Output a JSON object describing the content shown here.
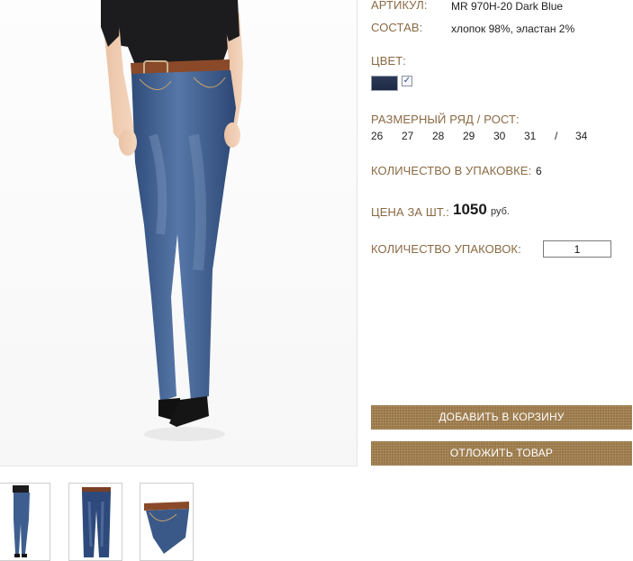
{
  "product": {
    "article_label": "АРТИКУЛ:",
    "article_value": "MR 970H-20 Dark Blue",
    "composition_label": "СОСТАВ:",
    "composition_value": "хлопок 98%, эластан 2%",
    "color_label": "ЦВЕТ:",
    "color_swatch": "#1f2b45",
    "color_checked_glyph": "✓",
    "size_label": "РАЗМЕРНЫЙ РЯД / РОСТ:",
    "sizes": [
      "26",
      "27",
      "28",
      "29",
      "30",
      "31",
      "/",
      "34"
    ],
    "pack_qty_label": "КОЛИЧЕСТВО В УПАКОВКЕ:",
    "pack_qty_value": "6",
    "price_label": "ЦЕНА ЗА ШТ.:",
    "price_value": "1050",
    "price_currency": "руб.",
    "packs_label": "КОЛИЧЕСТВО УПАКОВОК:",
    "packs_value": "1"
  },
  "actions": {
    "add_to_cart": "ДОБАВИТЬ В КОРЗИНУ",
    "defer": "ОТЛОЖИТЬ ТОВАР"
  },
  "colors": {
    "label_color": "#8a6a44",
    "button_color": "#9a7848",
    "denim": "#3b5a8a"
  }
}
